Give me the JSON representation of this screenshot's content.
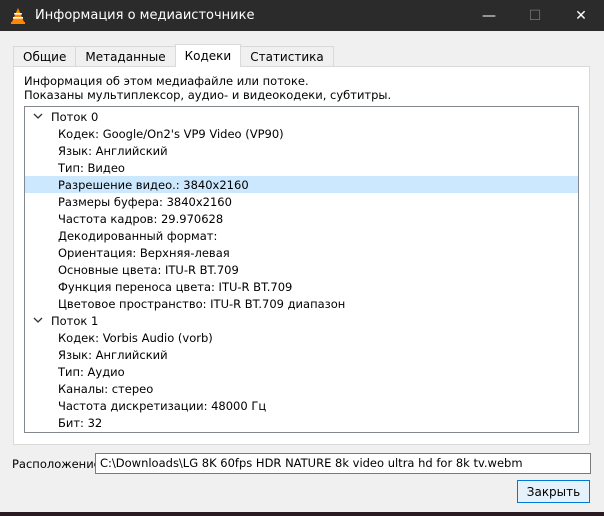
{
  "window": {
    "title": "Информация о медиаисточнике",
    "minimize_glyph": "—",
    "maximize_glyph": "☐",
    "close_glyph": "✕"
  },
  "tabs": [
    {
      "label": "Общие",
      "active": false
    },
    {
      "label": "Метаданные",
      "active": false
    },
    {
      "label": "Кодеки",
      "active": true
    },
    {
      "label": "Статистика",
      "active": false
    }
  ],
  "description": {
    "line1": "Информация об этом медиафайле или потоке.",
    "line2": "Показаны мультиплексор, аудио- и видеокодеки, субтитры."
  },
  "tree": {
    "streams": [
      {
        "label": "Поток 0",
        "expanded": true,
        "items": [
          "Кодек: Google/On2's VP9 Video (VP90)",
          "Язык: Английский",
          "Тип: Видео",
          "Разрешение видео.: 3840x2160",
          "Размеры буфера: 3840x2160",
          "Частота кадров: 29.970628",
          "Декодированный формат:",
          "Ориентация: Верхняя-левая",
          "Основные цвета: ITU-R BT.709",
          "Функция переноса цвета: ITU-R BT.709",
          "Цветовое пространство: ITU-R BT.709 диапазон"
        ]
      },
      {
        "label": "Поток 1",
        "expanded": true,
        "items": [
          "Кодек: Vorbis Audio (vorb)",
          "Язык: Английский",
          "Тип: Аудио",
          "Каналы: стерео",
          "Частота дискретизации: 48000 Гц",
          "Бит: 32"
        ]
      }
    ],
    "selected_item": "Разрешение видео.: 3840x2160"
  },
  "footer": {
    "location_label": "Расположение:",
    "location_value": "C:\\Downloads\\LG 8K 60fps HDR NATURE 8k video ultra hd for 8k tv.webm",
    "close_label": "Закрыть"
  },
  "colors": {
    "titlebar": "#2b2b2b",
    "selection": "#cce8ff",
    "accent": "#0078d7",
    "vlc_orange": "#ff8800"
  }
}
